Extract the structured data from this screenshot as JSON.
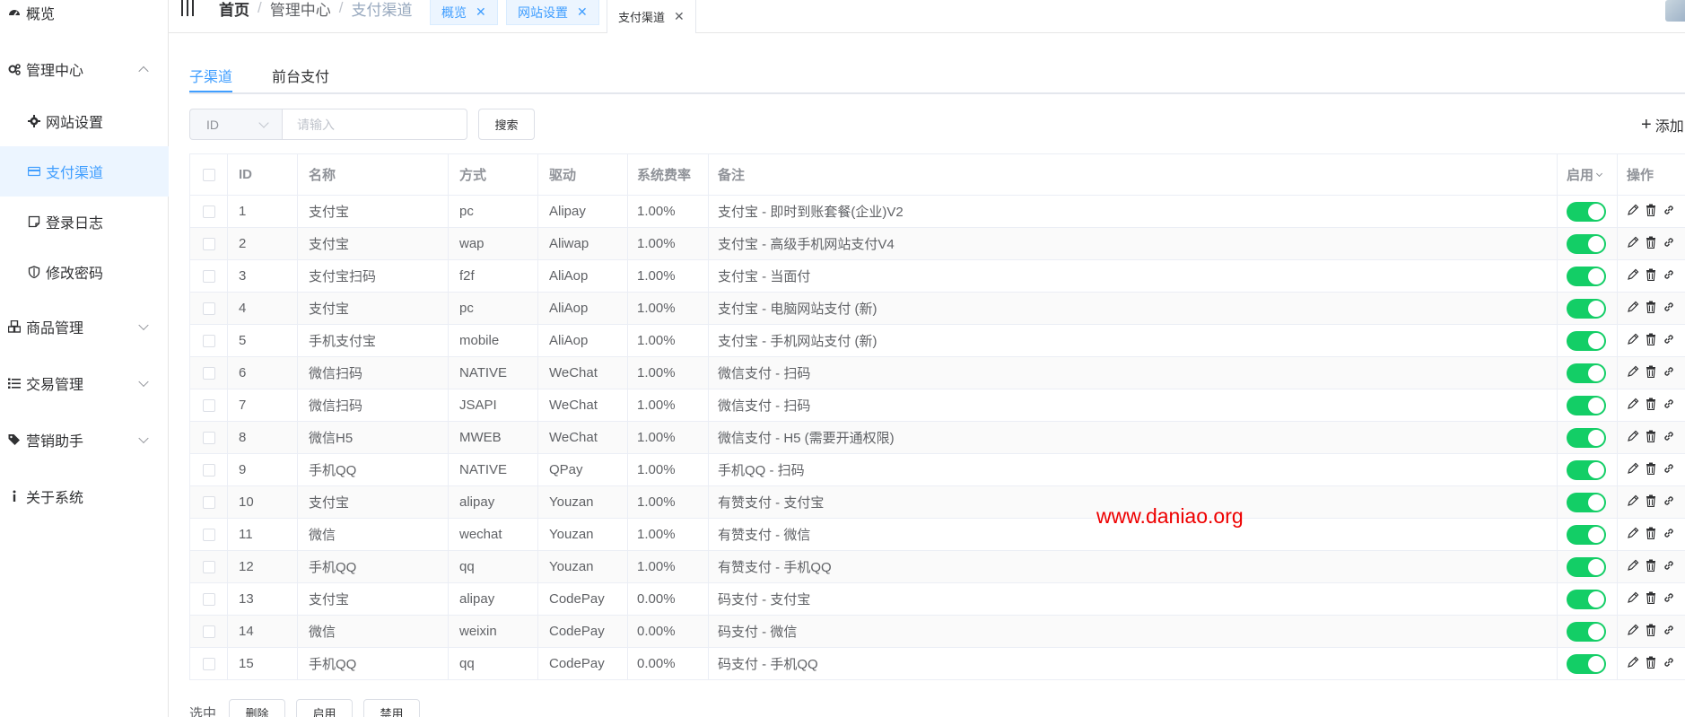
{
  "sidebar": {
    "items": [
      {
        "label": "概览",
        "icon": "dashboard-icon"
      },
      {
        "label": "管理中心",
        "icon": "gears-icon"
      },
      {
        "label": "网站设置",
        "icon": "gear-icon"
      },
      {
        "label": "支付渠道",
        "icon": "credit-card-icon"
      },
      {
        "label": "登录日志",
        "icon": "note-icon"
      },
      {
        "label": "修改密码",
        "icon": "shield-icon"
      },
      {
        "label": "商品管理",
        "icon": "cubes-icon"
      },
      {
        "label": "交易管理",
        "icon": "list-icon"
      },
      {
        "label": "营销助手",
        "icon": "tags-icon"
      },
      {
        "label": "关于系统",
        "icon": "info-icon"
      }
    ]
  },
  "header": {
    "breadcrumb": [
      "首页",
      "管理中心",
      "支付渠道"
    ],
    "tabs": [
      {
        "label": "概览"
      },
      {
        "label": "网站设置"
      },
      {
        "label": "支付渠道"
      }
    ]
  },
  "content_tabs": [
    "子渠道",
    "前台支付"
  ],
  "search": {
    "select_value": "ID",
    "placeholder": "请输入",
    "button": "搜索",
    "add_label": "添加"
  },
  "table": {
    "columns": [
      "ID",
      "名称",
      "方式",
      "驱动",
      "系统费率",
      "备注",
      "启用",
      "操作"
    ],
    "rows": [
      {
        "id": "1",
        "name": "支付宝",
        "method": "pc",
        "driver": "Alipay",
        "rate": "1.00%",
        "remark": "支付宝 - 即时到账套餐(企业)V2",
        "enabled": true
      },
      {
        "id": "2",
        "name": "支付宝",
        "method": "wap",
        "driver": "Aliwap",
        "rate": "1.00%",
        "remark": "支付宝 - 高级手机网站支付V4",
        "enabled": true
      },
      {
        "id": "3",
        "name": "支付宝扫码",
        "method": "f2f",
        "driver": "AliAop",
        "rate": "1.00%",
        "remark": "支付宝 - 当面付",
        "enabled": true
      },
      {
        "id": "4",
        "name": "支付宝",
        "method": "pc",
        "driver": "AliAop",
        "rate": "1.00%",
        "remark": "支付宝 - 电脑网站支付 (新)",
        "enabled": true
      },
      {
        "id": "5",
        "name": "手机支付宝",
        "method": "mobile",
        "driver": "AliAop",
        "rate": "1.00%",
        "remark": "支付宝 - 手机网站支付 (新)",
        "enabled": true
      },
      {
        "id": "6",
        "name": "微信扫码",
        "method": "NATIVE",
        "driver": "WeChat",
        "rate": "1.00%",
        "remark": "微信支付 - 扫码",
        "enabled": true
      },
      {
        "id": "7",
        "name": "微信扫码",
        "method": "JSAPI",
        "driver": "WeChat",
        "rate": "1.00%",
        "remark": "微信支付 - 扫码",
        "enabled": true
      },
      {
        "id": "8",
        "name": "微信H5",
        "method": "MWEB",
        "driver": "WeChat",
        "rate": "1.00%",
        "remark": "微信支付 - H5 (需要开通权限)",
        "enabled": true
      },
      {
        "id": "9",
        "name": "手机QQ",
        "method": "NATIVE",
        "driver": "QPay",
        "rate": "1.00%",
        "remark": "手机QQ - 扫码",
        "enabled": true
      },
      {
        "id": "10",
        "name": "支付宝",
        "method": "alipay",
        "driver": "Youzan",
        "rate": "1.00%",
        "remark": "有赞支付 - 支付宝",
        "enabled": true
      },
      {
        "id": "11",
        "name": "微信",
        "method": "wechat",
        "driver": "Youzan",
        "rate": "1.00%",
        "remark": "有赞支付 - 微信",
        "enabled": true
      },
      {
        "id": "12",
        "name": "手机QQ",
        "method": "qq",
        "driver": "Youzan",
        "rate": "1.00%",
        "remark": "有赞支付 - 手机QQ",
        "enabled": true
      },
      {
        "id": "13",
        "name": "支付宝",
        "method": "alipay",
        "driver": "CodePay",
        "rate": "0.00%",
        "remark": "码支付 - 支付宝",
        "enabled": true
      },
      {
        "id": "14",
        "name": "微信",
        "method": "weixin",
        "driver": "CodePay",
        "rate": "0.00%",
        "remark": "码支付 - 微信",
        "enabled": true
      },
      {
        "id": "15",
        "name": "手机QQ",
        "method": "qq",
        "driver": "CodePay",
        "rate": "0.00%",
        "remark": "码支付 - 手机QQ",
        "enabled": true
      }
    ]
  },
  "footer": {
    "label": "选中",
    "buttons": [
      "删除",
      "启用",
      "禁用"
    ]
  },
  "watermark": "www.daniao.org",
  "colors": {
    "primary": "#409eff",
    "switch_on": "#13ce66",
    "watermark": "#ee0000"
  }
}
